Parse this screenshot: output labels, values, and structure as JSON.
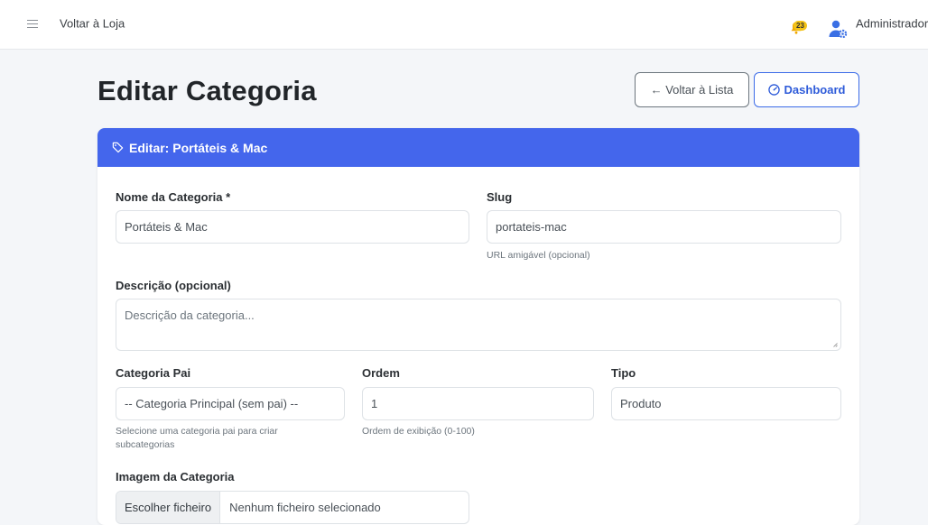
{
  "topbar": {
    "back_to_store": "Voltar à Loja",
    "notification_count": "23",
    "user_name": "Administrador"
  },
  "page": {
    "title": "Editar Categoria",
    "back_to_list": "← Voltar à Lista",
    "dashboard": "Dashboard"
  },
  "card": {
    "header": "Editar: Portáteis & Mac"
  },
  "form": {
    "name_label": "Nome da Categoria *",
    "name_value": "Portáteis & Mac",
    "slug_label": "Slug",
    "slug_value": "portateis-mac",
    "slug_help": "URL amigável (opcional)",
    "description_label": "Descrição (opcional)",
    "description_placeholder": "Descrição da categoria...",
    "parent_label": "Categoria Pai",
    "parent_value": "-- Categoria Principal (sem pai) --",
    "parent_help": "Selecione uma categoria pai para criar subcategorias",
    "order_label": "Ordem",
    "order_value": "1",
    "order_help": "Ordem de exibição (0-100)",
    "type_label": "Tipo",
    "type_value": "Produto",
    "image_label": "Imagem da Categoria",
    "file_button": "Escolher ficheiro",
    "file_status": "Nenhum ficheiro selecionado"
  }
}
